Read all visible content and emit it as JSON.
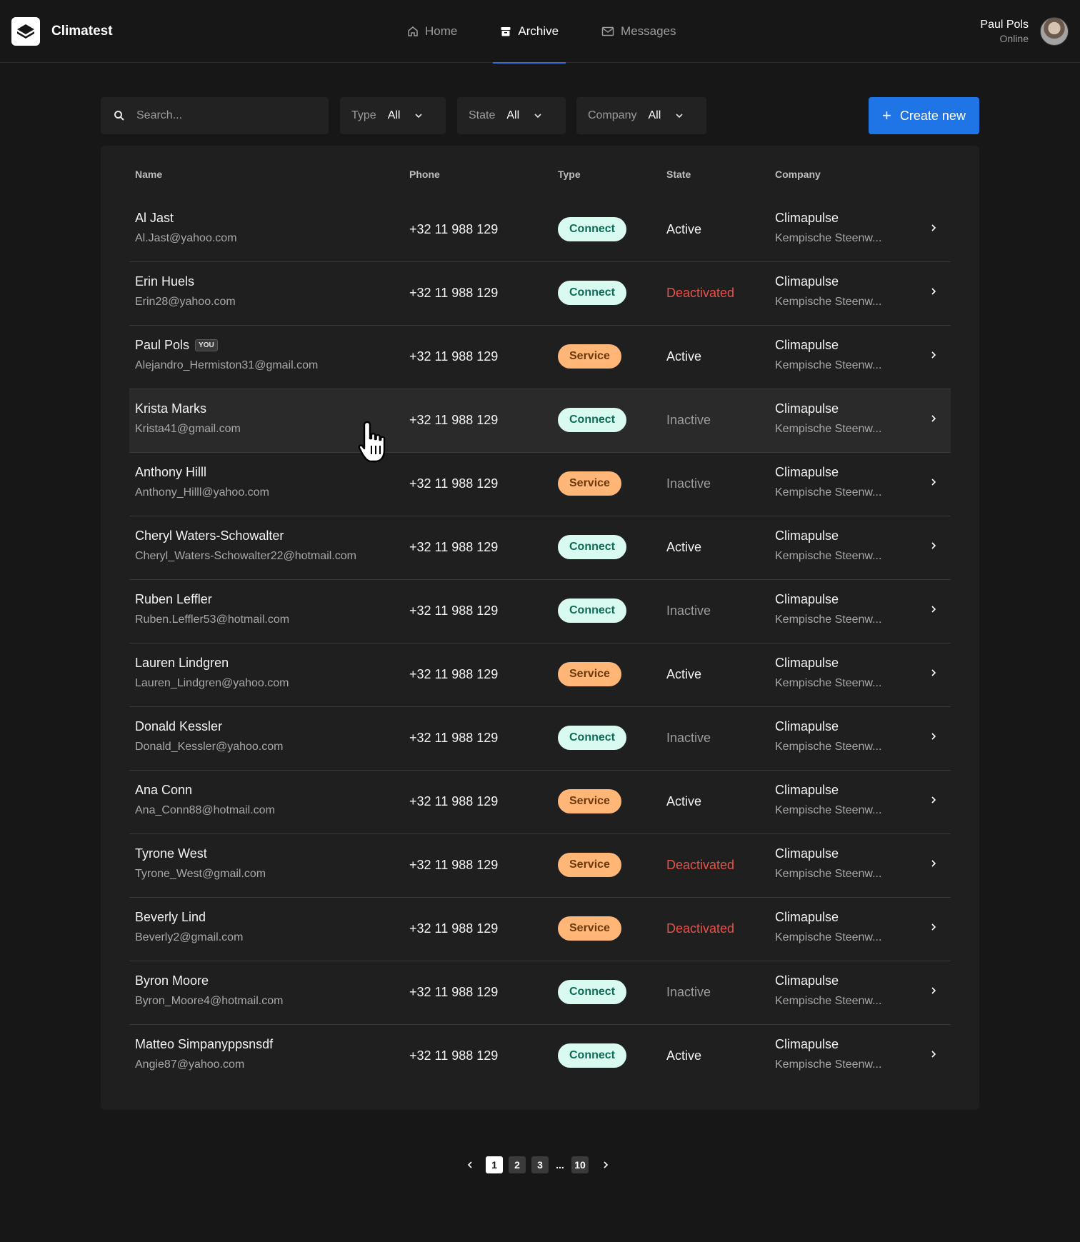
{
  "app": {
    "name": "Climatest"
  },
  "nav": [
    {
      "label": "Home",
      "icon": "home-icon",
      "active": false
    },
    {
      "label": "Archive",
      "icon": "archive-icon",
      "active": true
    },
    {
      "label": "Messages",
      "icon": "mail-icon",
      "active": false
    }
  ],
  "user": {
    "name": "Paul Pols",
    "status": "Online"
  },
  "toolbar": {
    "search_placeholder": "Search...",
    "filters": [
      {
        "label": "Type",
        "value": "All"
      },
      {
        "label": "State",
        "value": "All"
      },
      {
        "label": "Company",
        "value": "All"
      }
    ],
    "create_label": "Create new"
  },
  "table": {
    "columns": [
      "Name",
      "Phone",
      "Type",
      "State",
      "Company"
    ],
    "rows": [
      {
        "name": "Al Jast",
        "email": "Al.Jast@yahoo.com",
        "you": false,
        "phone": "+32 11 988 129",
        "type": "Connect",
        "state": "Active",
        "company": "Climapulse",
        "address": "Kempische Steenw..."
      },
      {
        "name": "Erin Huels",
        "email": "Erin28@yahoo.com",
        "you": false,
        "phone": "+32 11 988 129",
        "type": "Connect",
        "state": "Deactivated",
        "company": "Climapulse",
        "address": "Kempische Steenw..."
      },
      {
        "name": "Paul Pols",
        "email": "Alejandro_Hermiston31@gmail.com",
        "you": true,
        "phone": "+32 11 988 129",
        "type": "Service",
        "state": "Active",
        "company": "Climapulse",
        "address": "Kempische Steenw..."
      },
      {
        "name": "Krista Marks",
        "email": "Krista41@gmail.com",
        "you": false,
        "phone": "+32 11 988 129",
        "type": "Connect",
        "state": "Inactive",
        "company": "Climapulse",
        "address": "Kempische Steenw...",
        "hover": true
      },
      {
        "name": "Anthony Hilll",
        "email": "Anthony_Hilll@yahoo.com",
        "you": false,
        "phone": "+32 11 988 129",
        "type": "Service",
        "state": "Inactive",
        "company": "Climapulse",
        "address": "Kempische Steenw..."
      },
      {
        "name": "Cheryl Waters-Schowalter",
        "email": "Cheryl_Waters-Schowalter22@hotmail.com",
        "you": false,
        "phone": "+32 11 988 129",
        "type": "Connect",
        "state": "Active",
        "company": "Climapulse",
        "address": "Kempische Steenw..."
      },
      {
        "name": "Ruben Leffler",
        "email": "Ruben.Leffler53@hotmail.com",
        "you": false,
        "phone": "+32 11 988 129",
        "type": "Connect",
        "state": "Inactive",
        "company": "Climapulse",
        "address": "Kempische Steenw..."
      },
      {
        "name": "Lauren Lindgren",
        "email": "Lauren_Lindgren@yahoo.com",
        "you": false,
        "phone": "+32 11 988 129",
        "type": "Service",
        "state": "Active",
        "company": "Climapulse",
        "address": "Kempische Steenw..."
      },
      {
        "name": "Donald Kessler",
        "email": "Donald_Kessler@yahoo.com",
        "you": false,
        "phone": "+32 11 988 129",
        "type": "Connect",
        "state": "Inactive",
        "company": "Climapulse",
        "address": "Kempische Steenw..."
      },
      {
        "name": "Ana Conn",
        "email": "Ana_Conn88@hotmail.com",
        "you": false,
        "phone": "+32 11 988 129",
        "type": "Service",
        "state": "Active",
        "company": "Climapulse",
        "address": "Kempische Steenw..."
      },
      {
        "name": "Tyrone West",
        "email": "Tyrone_West@gmail.com",
        "you": false,
        "phone": "+32 11 988 129",
        "type": "Service",
        "state": "Deactivated",
        "company": "Climapulse",
        "address": "Kempische Steenw..."
      },
      {
        "name": "Beverly Lind",
        "email": "Beverly2@gmail.com",
        "you": false,
        "phone": "+32 11 988 129",
        "type": "Service",
        "state": "Deactivated",
        "company": "Climapulse",
        "address": "Kempische Steenw..."
      },
      {
        "name": "Byron Moore",
        "email": "Byron_Moore4@hotmail.com",
        "you": false,
        "phone": "+32 11 988 129",
        "type": "Connect",
        "state": "Inactive",
        "company": "Climapulse",
        "address": "Kempische Steenw..."
      },
      {
        "name": "Matteo Simpanyppsnsdf",
        "email": "Angie87@yahoo.com",
        "you": false,
        "phone": "+32 11 988 129",
        "type": "Connect",
        "state": "Active",
        "company": "Climapulse",
        "address": "Kempische Steenw..."
      }
    ],
    "you_badge": "YOU"
  },
  "pagination": {
    "pages": [
      "1",
      "2",
      "3"
    ],
    "ellipsis": "...",
    "last": "10",
    "current": "1"
  },
  "colors": {
    "accent": "#1f74e6",
    "connect_bg": "#d9faf0",
    "service_bg": "#ffb677",
    "deactivated": "#e5534b"
  }
}
